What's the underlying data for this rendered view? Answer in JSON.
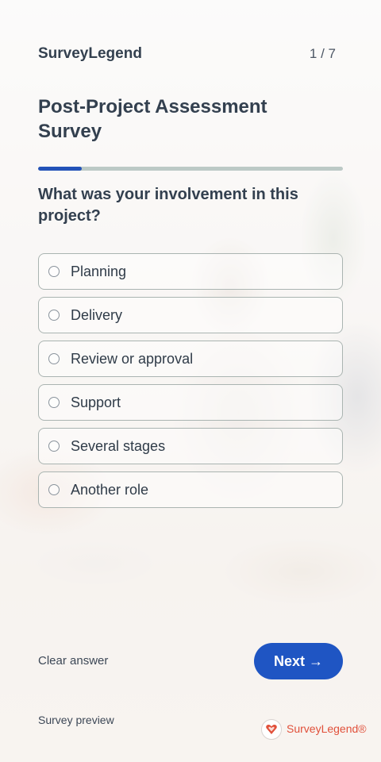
{
  "header": {
    "brand": "SurveyLegend",
    "pager": "1 / 7"
  },
  "survey": {
    "title": "Post-Project Assessment Survey",
    "progress_fraction": 0.143
  },
  "question": {
    "text": "What was your involvement in this project?",
    "options": [
      {
        "label": "Planning",
        "selected": false
      },
      {
        "label": "Delivery",
        "selected": false
      },
      {
        "label": "Review or approval",
        "selected": false
      },
      {
        "label": "Support",
        "selected": false
      },
      {
        "label": "Several stages",
        "selected": false
      },
      {
        "label": "Another role",
        "selected": false
      }
    ]
  },
  "actions": {
    "clear_label": "Clear answer",
    "next_label": "Next →"
  },
  "footer": {
    "preview_label": "Survey preview",
    "logo_text": "SurveyLegend®",
    "logo_color": "#e1503a"
  },
  "colors": {
    "accent": "#1f55c3",
    "progress_fill": "#2352b8",
    "progress_track": "#bcc9c6"
  }
}
